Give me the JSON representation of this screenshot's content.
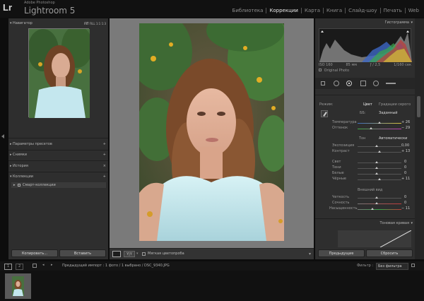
{
  "app": {
    "logo": "Lr",
    "adobe": "Adobe Photoshop",
    "name": "Lightroom 5"
  },
  "modules": [
    {
      "label": "Библиотека",
      "active": false
    },
    {
      "label": "Коррекции",
      "active": true
    },
    {
      "label": "Карта",
      "active": false
    },
    {
      "label": "Книга",
      "active": false
    },
    {
      "label": "Слайд-шоу",
      "active": false
    },
    {
      "label": "Печать",
      "active": false
    },
    {
      "label": "Web",
      "active": false
    }
  ],
  "left_panel": {
    "navigator": {
      "title": "Навигатор",
      "zoom": [
        "FIT",
        "FILL",
        "1:1",
        "1:3"
      ]
    },
    "sections": [
      {
        "title": "Параметры пресетов",
        "action": "+"
      },
      {
        "title": "Снимки",
        "action": "+"
      },
      {
        "title": "История",
        "action": "×"
      },
      {
        "title": "Коллекции",
        "action": "+"
      }
    ],
    "collection_item": "Смарт-коллекции",
    "copy_button": "Копировать...",
    "paste_button": "Вставить"
  },
  "toolbar": {
    "soft_proof": "Мягкая цветопроба"
  },
  "right_panel": {
    "histogram_title": "Гистограмма",
    "exif": [
      "ISO 160",
      "85 мм",
      "ƒ / 2,5",
      "1/160 сек"
    ],
    "original_label": "Original Photo",
    "treatment_label": "Режим:",
    "treatment_color": "Цвет",
    "treatment_bw": "Градации серого",
    "basic": {
      "wb_label": "ББ:",
      "wb_value": "Заданный",
      "temp_label": "Температура",
      "temp_value": "+ 26",
      "tint_label": "Оттенок",
      "tint_value": "− 29",
      "tone_label": "Тон",
      "tone_auto": "Автоматически",
      "exposure_label": "Экспозиция",
      "exposure_value": "0,00",
      "contrast_label": "Контраст",
      "contrast_value": "+ 13",
      "highlights_label": "Свет",
      "highlights_value": "0",
      "shadows_label": "Тени",
      "shadows_value": "0",
      "whites_label": "Белые",
      "whites_value": "0",
      "blacks_label": "Чёрные",
      "blacks_value": "+ 11",
      "presence_label": "Внешний вид",
      "clarity_label": "Четкость",
      "clarity_value": "0",
      "vibrance_label": "Сочность",
      "vibrance_value": "0",
      "saturation_label": "Насыщенность",
      "saturation_value": "− 11"
    },
    "tone_curve_title": "Тоновая кривая",
    "previous_button": "Предыдущие",
    "reset_button": "Сбросить"
  },
  "filmstrip": {
    "pages": [
      "1",
      "2"
    ],
    "path": "Предыдущий импорт : 1 фото / 1 выбрано / DSC_9340.JPG",
    "filter_label": "Фильтр :",
    "filter_value": "Без фильтра"
  }
}
